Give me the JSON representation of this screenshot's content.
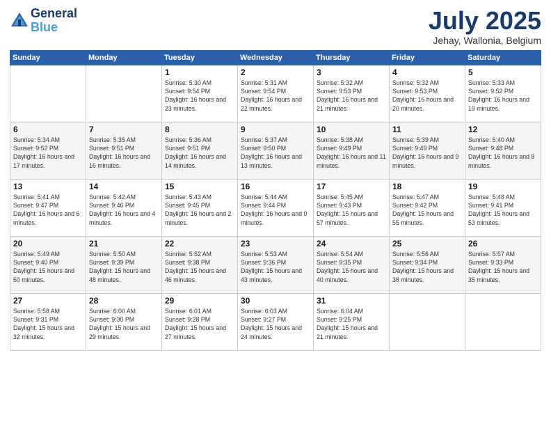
{
  "header": {
    "logo_line1": "General",
    "logo_line2": "Blue",
    "month": "July 2025",
    "location": "Jehay, Wallonia, Belgium"
  },
  "days_of_week": [
    "Sunday",
    "Monday",
    "Tuesday",
    "Wednesday",
    "Thursday",
    "Friday",
    "Saturday"
  ],
  "weeks": [
    [
      {
        "day": "",
        "sunrise": "",
        "sunset": "",
        "daylight": ""
      },
      {
        "day": "",
        "sunrise": "",
        "sunset": "",
        "daylight": ""
      },
      {
        "day": "1",
        "sunrise": "Sunrise: 5:30 AM",
        "sunset": "Sunset: 9:54 PM",
        "daylight": "Daylight: 16 hours and 23 minutes."
      },
      {
        "day": "2",
        "sunrise": "Sunrise: 5:31 AM",
        "sunset": "Sunset: 9:54 PM",
        "daylight": "Daylight: 16 hours and 22 minutes."
      },
      {
        "day": "3",
        "sunrise": "Sunrise: 5:32 AM",
        "sunset": "Sunset: 9:53 PM",
        "daylight": "Daylight: 16 hours and 21 minutes."
      },
      {
        "day": "4",
        "sunrise": "Sunrise: 5:32 AM",
        "sunset": "Sunset: 9:53 PM",
        "daylight": "Daylight: 16 hours and 20 minutes."
      },
      {
        "day": "5",
        "sunrise": "Sunrise: 5:33 AM",
        "sunset": "Sunset: 9:52 PM",
        "daylight": "Daylight: 16 hours and 19 minutes."
      }
    ],
    [
      {
        "day": "6",
        "sunrise": "Sunrise: 5:34 AM",
        "sunset": "Sunset: 9:52 PM",
        "daylight": "Daylight: 16 hours and 17 minutes."
      },
      {
        "day": "7",
        "sunrise": "Sunrise: 5:35 AM",
        "sunset": "Sunset: 9:51 PM",
        "daylight": "Daylight: 16 hours and 16 minutes."
      },
      {
        "day": "8",
        "sunrise": "Sunrise: 5:36 AM",
        "sunset": "Sunset: 9:51 PM",
        "daylight": "Daylight: 16 hours and 14 minutes."
      },
      {
        "day": "9",
        "sunrise": "Sunrise: 5:37 AM",
        "sunset": "Sunset: 9:50 PM",
        "daylight": "Daylight: 16 hours and 13 minutes."
      },
      {
        "day": "10",
        "sunrise": "Sunrise: 5:38 AM",
        "sunset": "Sunset: 9:49 PM",
        "daylight": "Daylight: 16 hours and 11 minutes."
      },
      {
        "day": "11",
        "sunrise": "Sunrise: 5:39 AM",
        "sunset": "Sunset: 9:49 PM",
        "daylight": "Daylight: 16 hours and 9 minutes."
      },
      {
        "day": "12",
        "sunrise": "Sunrise: 5:40 AM",
        "sunset": "Sunset: 9:48 PM",
        "daylight": "Daylight: 16 hours and 8 minutes."
      }
    ],
    [
      {
        "day": "13",
        "sunrise": "Sunrise: 5:41 AM",
        "sunset": "Sunset: 9:47 PM",
        "daylight": "Daylight: 16 hours and 6 minutes."
      },
      {
        "day": "14",
        "sunrise": "Sunrise: 5:42 AM",
        "sunset": "Sunset: 9:46 PM",
        "daylight": "Daylight: 16 hours and 4 minutes."
      },
      {
        "day": "15",
        "sunrise": "Sunrise: 5:43 AM",
        "sunset": "Sunset: 9:45 PM",
        "daylight": "Daylight: 16 hours and 2 minutes."
      },
      {
        "day": "16",
        "sunrise": "Sunrise: 5:44 AM",
        "sunset": "Sunset: 9:44 PM",
        "daylight": "Daylight: 16 hours and 0 minutes."
      },
      {
        "day": "17",
        "sunrise": "Sunrise: 5:45 AM",
        "sunset": "Sunset: 9:43 PM",
        "daylight": "Daylight: 15 hours and 57 minutes."
      },
      {
        "day": "18",
        "sunrise": "Sunrise: 5:47 AM",
        "sunset": "Sunset: 9:42 PM",
        "daylight": "Daylight: 15 hours and 55 minutes."
      },
      {
        "day": "19",
        "sunrise": "Sunrise: 5:48 AM",
        "sunset": "Sunset: 9:41 PM",
        "daylight": "Daylight: 15 hours and 53 minutes."
      }
    ],
    [
      {
        "day": "20",
        "sunrise": "Sunrise: 5:49 AM",
        "sunset": "Sunset: 9:40 PM",
        "daylight": "Daylight: 15 hours and 50 minutes."
      },
      {
        "day": "21",
        "sunrise": "Sunrise: 5:50 AM",
        "sunset": "Sunset: 9:39 PM",
        "daylight": "Daylight: 15 hours and 48 minutes."
      },
      {
        "day": "22",
        "sunrise": "Sunrise: 5:52 AM",
        "sunset": "Sunset: 9:38 PM",
        "daylight": "Daylight: 15 hours and 46 minutes."
      },
      {
        "day": "23",
        "sunrise": "Sunrise: 5:53 AM",
        "sunset": "Sunset: 9:36 PM",
        "daylight": "Daylight: 15 hours and 43 minutes."
      },
      {
        "day": "24",
        "sunrise": "Sunrise: 5:54 AM",
        "sunset": "Sunset: 9:35 PM",
        "daylight": "Daylight: 15 hours and 40 minutes."
      },
      {
        "day": "25",
        "sunrise": "Sunrise: 5:56 AM",
        "sunset": "Sunset: 9:34 PM",
        "daylight": "Daylight: 15 hours and 38 minutes."
      },
      {
        "day": "26",
        "sunrise": "Sunrise: 5:57 AM",
        "sunset": "Sunset: 9:33 PM",
        "daylight": "Daylight: 15 hours and 35 minutes."
      }
    ],
    [
      {
        "day": "27",
        "sunrise": "Sunrise: 5:58 AM",
        "sunset": "Sunset: 9:31 PM",
        "daylight": "Daylight: 15 hours and 32 minutes."
      },
      {
        "day": "28",
        "sunrise": "Sunrise: 6:00 AM",
        "sunset": "Sunset: 9:30 PM",
        "daylight": "Daylight: 15 hours and 29 minutes."
      },
      {
        "day": "29",
        "sunrise": "Sunrise: 6:01 AM",
        "sunset": "Sunset: 9:28 PM",
        "daylight": "Daylight: 15 hours and 27 minutes."
      },
      {
        "day": "30",
        "sunrise": "Sunrise: 6:03 AM",
        "sunset": "Sunset: 9:27 PM",
        "daylight": "Daylight: 15 hours and 24 minutes."
      },
      {
        "day": "31",
        "sunrise": "Sunrise: 6:04 AM",
        "sunset": "Sunset: 9:25 PM",
        "daylight": "Daylight: 15 hours and 21 minutes."
      },
      {
        "day": "",
        "sunrise": "",
        "sunset": "",
        "daylight": ""
      },
      {
        "day": "",
        "sunrise": "",
        "sunset": "",
        "daylight": ""
      }
    ]
  ]
}
